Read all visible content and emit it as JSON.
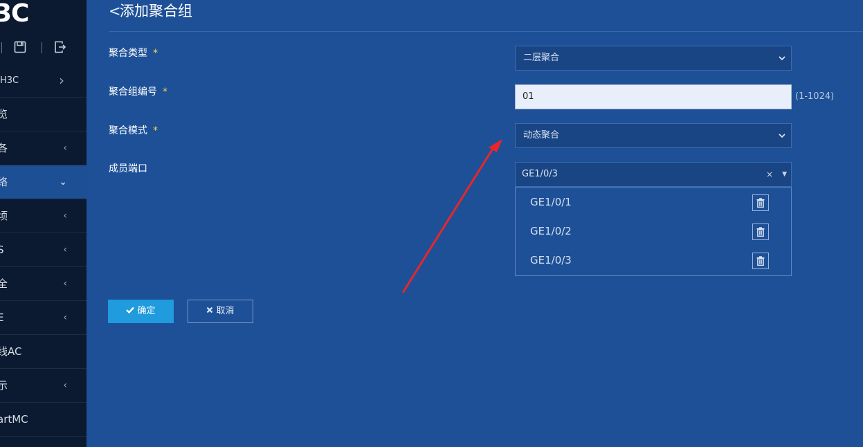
{
  "sidebar": {
    "logo_text": "3C",
    "toolbar": {
      "icons": [
        "save-icon",
        "logout-icon"
      ]
    },
    "nav_items": [
      {
        "label": "H3C",
        "chevron": "›"
      },
      {
        "label": "览",
        "chevron": ""
      },
      {
        "label": "各",
        "chevron": "‹"
      },
      {
        "label": "络",
        "chevron": "⌄"
      },
      {
        "label": "顷",
        "chevron": "‹"
      },
      {
        "label": "S",
        "chevron": "‹"
      },
      {
        "label": "全",
        "chevron": "‹"
      },
      {
        "label": "E",
        "chevron": "‹"
      },
      {
        "label": "线AC",
        "chevron": ""
      },
      {
        "label": "示",
        "chevron": "‹"
      },
      {
        "label": "artMC",
        "chevron": ""
      }
    ]
  },
  "header": {
    "back": "<",
    "title": "添加聚合组"
  },
  "form": {
    "required_mark": "*",
    "agg_type": {
      "label": "聚合类型",
      "value": "二层聚合"
    },
    "group_id": {
      "label": "聚合组编号",
      "value": "01",
      "hint": "(1-1024)"
    },
    "agg_mode": {
      "label": "聚合模式",
      "value": "动态聚合"
    },
    "members": {
      "label": "成员端口",
      "selected": "GE1/0/3",
      "clear": "×",
      "caret": "▼",
      "items": [
        "GE1/0/1",
        "GE1/0/2",
        "GE1/0/3"
      ]
    }
  },
  "buttons": {
    "ok": "确定",
    "cancel": "取消"
  },
  "colors": {
    "background": "#1e5097",
    "sidebar": "#0b1a30",
    "accent": "#1f9bde",
    "required": "#f6d94b",
    "arrow": "#e8262a"
  }
}
